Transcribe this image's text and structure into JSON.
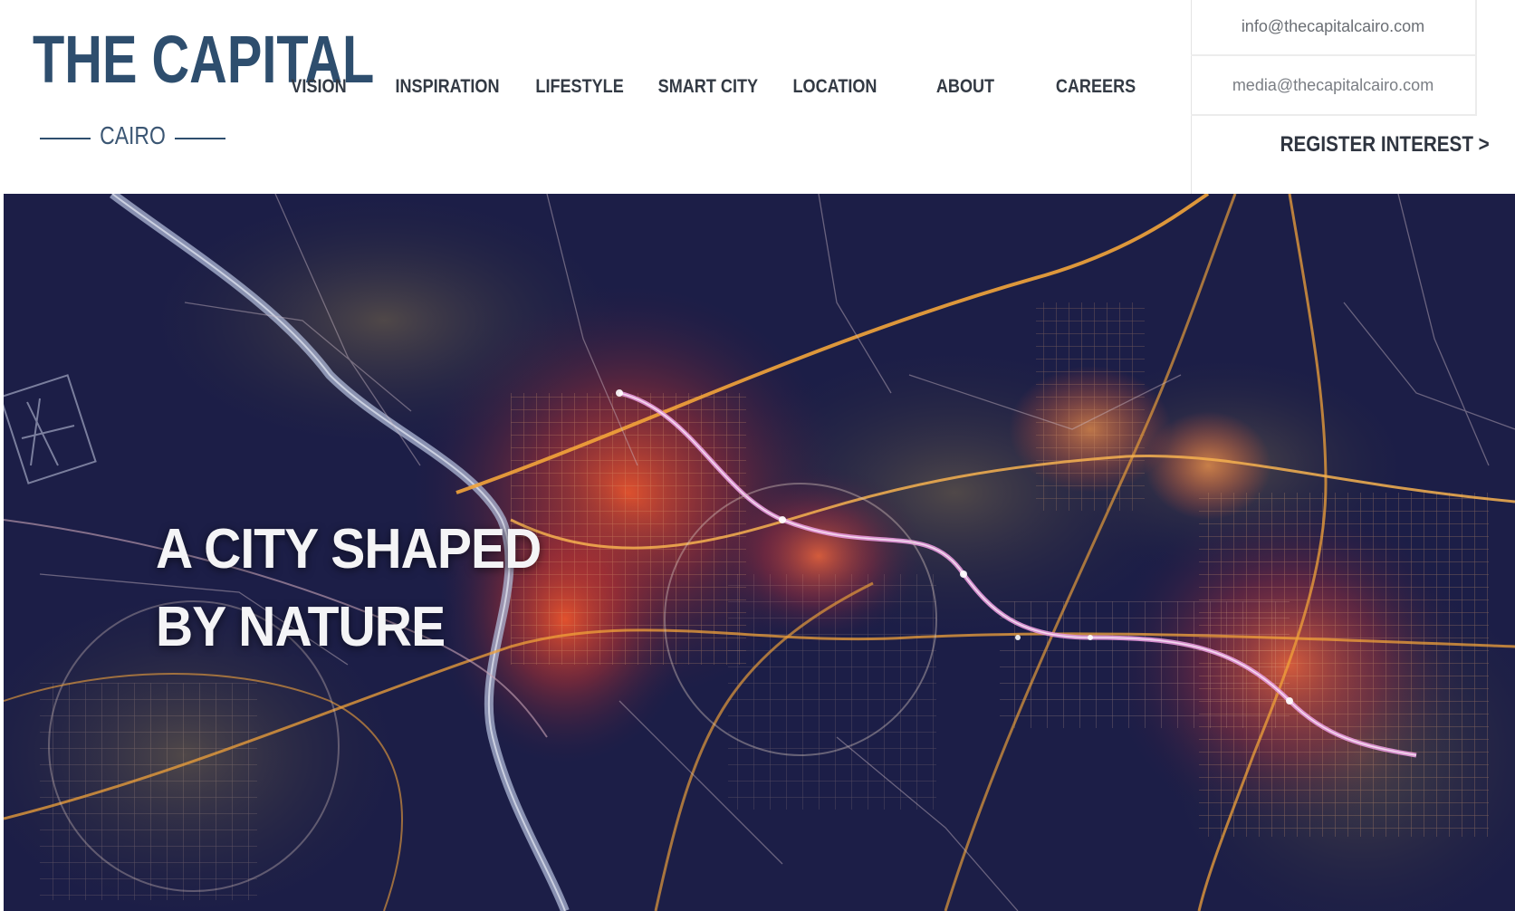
{
  "logo": {
    "main": "THE CAPITAL",
    "sub": "CAIRO"
  },
  "nav": {
    "items": [
      {
        "label": "VISION"
      },
      {
        "label": "INSPIRATION"
      },
      {
        "label": "LIFESTYLE"
      },
      {
        "label": "SMART CITY"
      },
      {
        "label": "LOCATION"
      },
      {
        "label": "ABOUT"
      },
      {
        "label": "CAREERS"
      }
    ]
  },
  "contact": {
    "email_info": "info@thecapitalcairo.com",
    "email_media": "media@thecapitalcairo.com",
    "register": "REGISTER INTEREST >"
  },
  "hero": {
    "line1": "A CITY SHAPED",
    "line2": "BY NATURE"
  },
  "colors": {
    "brand": "#2e4e6e",
    "hero_background": "#1b1d45",
    "road_orange": "#f0a23a",
    "road_pink": "#e59ad8",
    "river": "#b9c2dc"
  }
}
